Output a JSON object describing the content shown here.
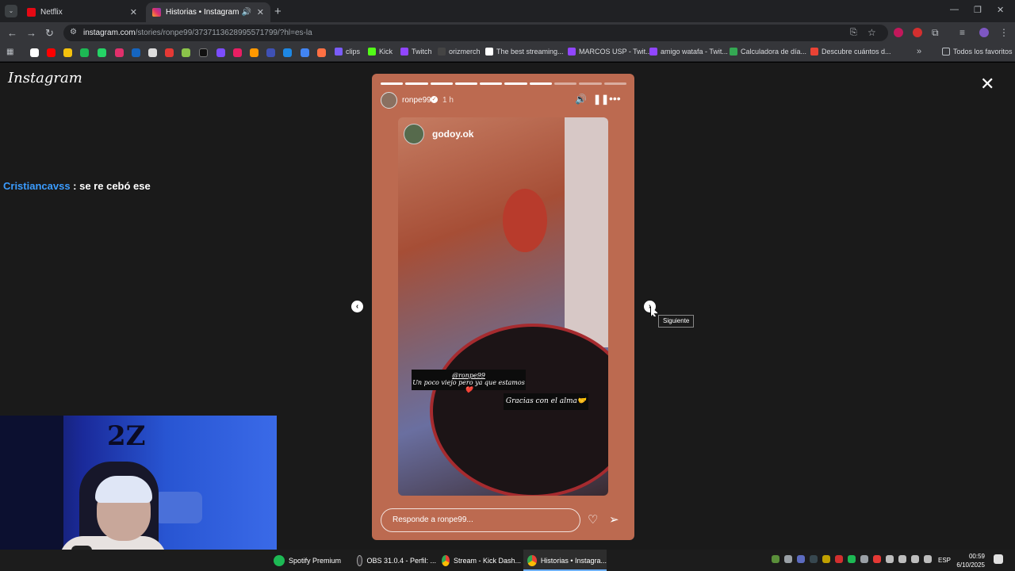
{
  "browser": {
    "tabs": [
      {
        "title": "Netflix",
        "active": false,
        "favicon_color": "#e50914"
      },
      {
        "title": "Historias • Instagram",
        "active": true,
        "favicon_color": "#e1306c"
      }
    ],
    "url_host": "instagram.com",
    "url_path": "/stories/ronpe99/3737113628995571799/?hl=es-la",
    "bookmarks": [
      {
        "label": "clips",
        "color": "#7a5cfa"
      },
      {
        "label": "Kick",
        "color": "#53fc18"
      },
      {
        "label": "Twitch",
        "color": "#9146ff"
      },
      {
        "label": "orizmerch",
        "color": "#444444"
      },
      {
        "label": "The best streaming...",
        "color": "#ffffff"
      },
      {
        "label": "MARCOS USP - Twit...",
        "color": "#9146ff"
      },
      {
        "label": "amigo watafa - Twit...",
        "color": "#9146ff"
      },
      {
        "label": "Calculadora de día...",
        "color": "#34a853"
      },
      {
        "label": "Descubre cuántos d...",
        "color": "#ea4335"
      }
    ],
    "all_bookmarks_label": "Todos los favoritos"
  },
  "instagram": {
    "logo": "Instagram",
    "story": {
      "username": "ronpe99",
      "time": "1 h",
      "segments_total": 10,
      "segments_done": 7,
      "video_username": "godoy.ok",
      "caption_mention": "@ronpe99",
      "caption_line1": "Un poco viejo pero ya que estamos ❤️",
      "caption_line2": "Gracias con el alma🤝",
      "reply_placeholder": "Responde a ronpe99..."
    },
    "next_tooltip": "Siguiente"
  },
  "chat": {
    "user": "Cristiancavss",
    "message": " : se re cebó ese"
  },
  "webcam": {
    "wall_tag": "2Z"
  },
  "taskbar": {
    "apps": [
      {
        "label": "Spotify Premium",
        "color": "#1db954",
        "active": false
      },
      {
        "label": "OBS 31.0.4 - Perfil: ...",
        "color": "#302e31",
        "active": false
      },
      {
        "label": "Stream - Kick Dash...",
        "color": "#4285f4",
        "active": false
      },
      {
        "label": "Historias • Instagra...",
        "color": "#4285f4",
        "active": true
      }
    ],
    "language": "ESP",
    "time": "00:59",
    "date": "6/10/2025"
  }
}
